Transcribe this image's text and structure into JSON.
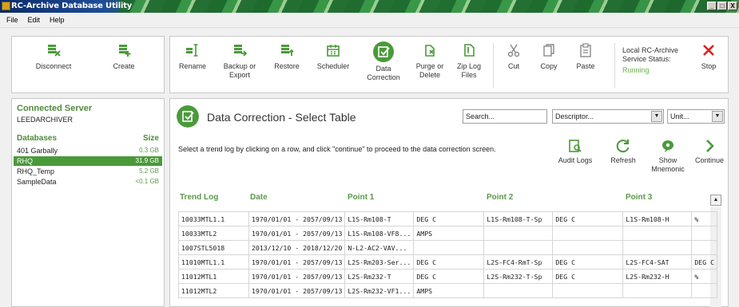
{
  "window": {
    "title": "RC-Archive Database Utility",
    "controls": [
      "_",
      "□",
      "X"
    ]
  },
  "menu": [
    "File",
    "Edit",
    "Help"
  ],
  "left_tools": {
    "disconnect": "Disconnect",
    "create": "Create"
  },
  "connected": {
    "heading": "Connected Server",
    "server": "LEEDARCHIVER"
  },
  "databases": {
    "heading": "Databases",
    "size_heading": "Size",
    "items": [
      {
        "name": "401 Garbally",
        "size": "0.3 GB",
        "selected": false
      },
      {
        "name": "RHQ",
        "size": "31.9 GB",
        "selected": true
      },
      {
        "name": "RHQ_Temp",
        "size": "5.2 GB",
        "selected": false
      },
      {
        "name": "SampleData",
        "size": "<0.1 GB",
        "selected": false
      }
    ]
  },
  "toolbar": {
    "rename": "Rename",
    "backup_export_1": "Backup or",
    "backup_export_2": "Export",
    "restore": "Restore",
    "scheduler": "Scheduler",
    "data_correction_1": "Data",
    "data_correction_2": "Correction",
    "purge_delete_1": "Purge or",
    "purge_delete_2": "Delete",
    "zip_log_1": "Zip Log",
    "zip_log_2": "Files",
    "cut": "Cut",
    "copy": "Copy",
    "paste": "Paste",
    "status_line1": "Local RC-Archive",
    "status_line2": "Service Status:",
    "status_value": "Running",
    "stop": "Stop"
  },
  "main": {
    "title": "Data Correction - Select Table",
    "search_value": "Search...",
    "descriptor_value": "Descriptor...",
    "unit_value": "Unit...",
    "instruction": "Select a trend log by clicking on a row, and click \"continue\" to proceed to the data correction screen.",
    "actions": {
      "audit_logs": "Audit Logs",
      "refresh": "Refresh",
      "show_mnemonic_1": "Show",
      "show_mnemonic_2": "Mnemonic",
      "continue": "Continue"
    },
    "columns": {
      "trend_log": "Trend Log",
      "date": "Date",
      "point1": "Point 1",
      "point2": "Point 2",
      "point3": "Point 3"
    },
    "rows": [
      [
        "10033MTL1.1",
        "1970/01/01 - 2057/09/13",
        "L1S-Rm108-T",
        "DEG C",
        "L1S-Rm108-T-Sp",
        "DEG C",
        "L1S-Rm108-H",
        "%"
      ],
      [
        "10033MTL2",
        "1970/01/01 - 2057/09/13",
        "L1S-Rm108-VF8...",
        "AMPS",
        "",
        "",
        "",
        ""
      ],
      [
        "1007STL5018",
        "2013/12/10 - 2018/12/20",
        "N-L2-AC2-VAV...",
        "",
        "",
        "",
        "",
        ""
      ],
      [
        "11010MTL1.1",
        "1970/01/01 - 2057/09/13",
        "L2S-Rm203-Ser...",
        "DEG C",
        "L2S-FC4-RmT-Sp",
        "DEG C",
        "L2S-FC4-SAT",
        "DEG C"
      ],
      [
        "11012MTL1",
        "1970/01/01 - 2057/09/13",
        "L2S-Rm232-T",
        "DEG C",
        "L2S-Rm232-T-Sp",
        "DEG C",
        "L2S-Rm232-H",
        "%"
      ],
      [
        "11012MTL2",
        "1970/01/01 - 2057/09/13",
        "L2S-Rm232-VF1...",
        "AMPS",
        "",
        "",
        "",
        ""
      ]
    ]
  },
  "colors": {
    "accent": "#4a9a3a",
    "stop": "#e02020",
    "header_green": "#5a9a48"
  }
}
